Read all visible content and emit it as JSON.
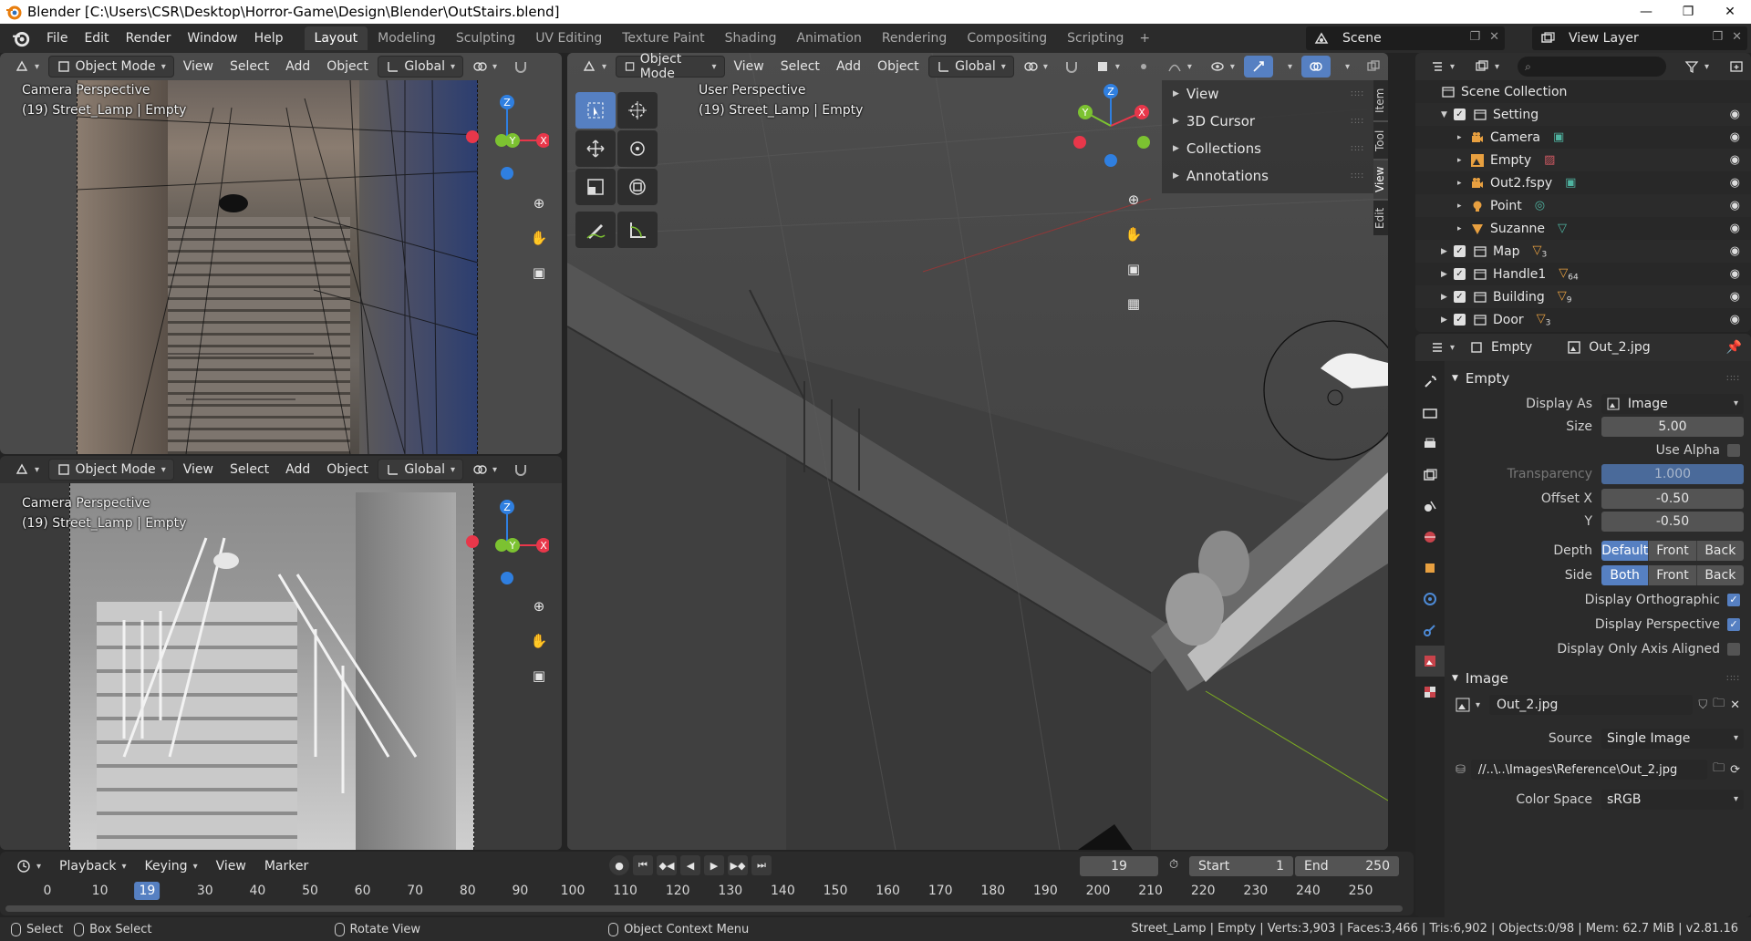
{
  "window": {
    "title": "Blender [C:\\Users\\CSR\\Desktop\\Horror-Game\\Design\\Blender\\OutStairs.blend]",
    "min": "—",
    "max": "❐",
    "close": "✕"
  },
  "menubar": {
    "items": [
      "File",
      "Edit",
      "Render",
      "Window",
      "Help"
    ],
    "workspaces": [
      "Layout",
      "Modeling",
      "Sculpting",
      "UV Editing",
      "Texture Paint",
      "Shading",
      "Animation",
      "Rendering",
      "Compositing",
      "Scripting"
    ],
    "plus": "+",
    "scene": "Scene",
    "view_layer": "View Layer"
  },
  "viewport_header": {
    "mode": "Object Mode",
    "menus": [
      "View",
      "Select",
      "Add",
      "Object"
    ],
    "orientation": "Global"
  },
  "viewports": {
    "top_left": {
      "line1": "Camera Perspective",
      "line2": "(19) Street_Lamp | Empty"
    },
    "bottom_left": {
      "line1": "Camera Perspective",
      "line2": "(19) Street_Lamp | Empty"
    },
    "main": {
      "line1": "User Perspective",
      "line2": "(19) Street_Lamp | Empty"
    }
  },
  "gizmo": {
    "z": "Z",
    "y": "Y",
    "x": "X"
  },
  "npanel": {
    "items": [
      "View",
      "3D Cursor",
      "Collections",
      "Annotations"
    ],
    "tabs": [
      "Item",
      "Tool",
      "View",
      "Edit"
    ]
  },
  "outliner": {
    "root": "Scene Collection",
    "rows": [
      {
        "name": "Setting",
        "type": "collection",
        "level": 1,
        "badge": ""
      },
      {
        "name": "Camera",
        "type": "camera",
        "level": 2,
        "badge": ""
      },
      {
        "name": "Empty",
        "type": "empty",
        "level": 2,
        "badge": ""
      },
      {
        "name": "Out2.fspy",
        "type": "camera",
        "level": 2,
        "badge": ""
      },
      {
        "name": "Point",
        "type": "light",
        "level": 2,
        "badge": ""
      },
      {
        "name": "Suzanne",
        "type": "mesh",
        "level": 2,
        "badge": ""
      },
      {
        "name": "Map",
        "type": "collection",
        "level": 1,
        "badge": "3"
      },
      {
        "name": "Handle1",
        "type": "collection",
        "level": 1,
        "badge": "64"
      },
      {
        "name": "Building",
        "type": "collection",
        "level": 1,
        "badge": "9"
      },
      {
        "name": "Door",
        "type": "collection",
        "level": 1,
        "badge": "3"
      }
    ]
  },
  "properties": {
    "header_object": "Empty",
    "header_image": "Out_2.jpg",
    "empty_panel": {
      "title": "Empty",
      "display_as_label": "Display As",
      "display_as": "Image",
      "size_label": "Size",
      "size": "5.00",
      "use_alpha": "Use Alpha",
      "transparency_label": "Transparency",
      "transparency": "1.000",
      "offset_x_label": "Offset X",
      "offset_x": "-0.50",
      "offset_y_label": "Y",
      "offset_y": "-0.50",
      "depth_label": "Depth",
      "depth_options": [
        "Default",
        "Front",
        "Back"
      ],
      "side_label": "Side",
      "side_options": [
        "Both",
        "Front",
        "Back"
      ],
      "display_ortho": "Display Orthographic",
      "display_persp": "Display Perspective",
      "display_axis": "Display Only Axis Aligned"
    },
    "image_panel": {
      "title": "Image",
      "image_name": "Out_2.jpg",
      "source_label": "Source",
      "source": "Single Image",
      "filepath": "//..\\..\\Images\\Reference\\Out_2.jpg",
      "colorspace_label": "Color Space",
      "colorspace": "sRGB"
    }
  },
  "timeline": {
    "menus": [
      "Playback",
      "Keying",
      "View",
      "Marker"
    ],
    "current_frame": "19",
    "start_label": "Start",
    "start": "1",
    "end_label": "End",
    "end": "250",
    "ticks": [
      "0",
      "10",
      "19",
      "30",
      "40",
      "50",
      "60",
      "70",
      "80",
      "90",
      "100",
      "110",
      "120",
      "130",
      "140",
      "150",
      "160",
      "170",
      "180",
      "190",
      "200",
      "210",
      "220",
      "230",
      "240",
      "250"
    ]
  },
  "statusbar": {
    "select": "Select",
    "box_select": "Box Select",
    "rotate_view": "Rotate View",
    "context_menu": "Object Context Menu",
    "stats": "Street_Lamp | Empty | Verts:3,903 | Faces:3,466 | Tris:6,902 | Objects:0/98 | Mem: 62.7 MiB | v2.81.16"
  },
  "colors": {
    "accent": "#5680c2",
    "axis_x": "#e8374a",
    "axis_y": "#7cc231",
    "axis_z": "#2f7fe0",
    "collection_badge": "#e8a040"
  }
}
